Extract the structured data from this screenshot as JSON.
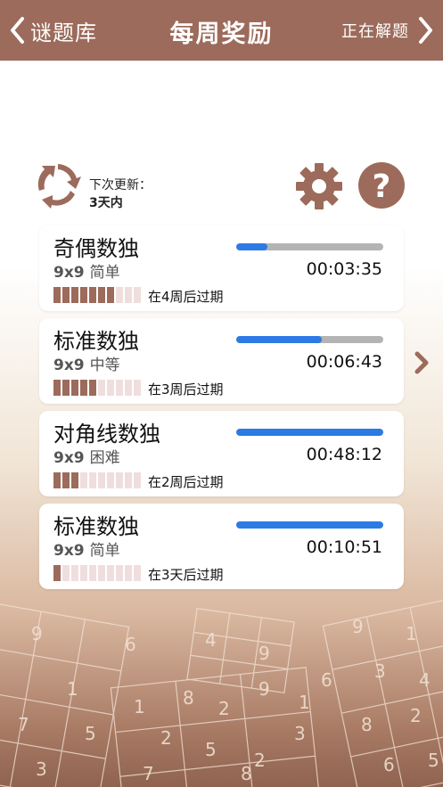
{
  "nav": {
    "back_label": "谜题库",
    "title": "每周奖励",
    "next_label": "正在解题"
  },
  "update": {
    "label": "下次更新：",
    "value": "3天内"
  },
  "icons": {
    "refresh": "refresh-icon",
    "settings": "gear-icon",
    "help": "help-icon"
  },
  "colors": {
    "accent": "#9c6b5b",
    "progress": "#2c7be5",
    "track": "#b4b4b4"
  },
  "cards": [
    {
      "name": "奇偶数独",
      "size": "9x9",
      "difficulty": "简单",
      "time": "00:03:35",
      "progress": 0.21,
      "blocks_filled": 7,
      "blocks_total": 10,
      "expire": "在4周后过期"
    },
    {
      "name": "标准数独",
      "size": "9x9",
      "difficulty": "中等",
      "time": "00:06:43",
      "progress": 0.58,
      "blocks_filled": 5,
      "blocks_total": 10,
      "expire": "在3周后过期"
    },
    {
      "name": "对角线数独",
      "size": "9x9",
      "difficulty": "困难",
      "time": "00:48:12",
      "progress": 1.0,
      "blocks_filled": 3,
      "blocks_total": 10,
      "expire": "在2周后过期"
    },
    {
      "name": "标准数独",
      "size": "9x9",
      "difficulty": "简单",
      "time": "00:10:51",
      "progress": 1.0,
      "blocks_filled": 1,
      "blocks_total": 10,
      "expire": "在3天后过期"
    }
  ],
  "background_digits": [
    "9",
    "1",
    "7",
    "5",
    "3",
    "6",
    "1",
    "8",
    "2",
    "9",
    "1",
    "6",
    "2",
    "5",
    "2",
    "3",
    "7",
    "8",
    "9",
    "1",
    "3",
    "4",
    "8",
    "2",
    "6",
    "5",
    "4",
    "9"
  ]
}
